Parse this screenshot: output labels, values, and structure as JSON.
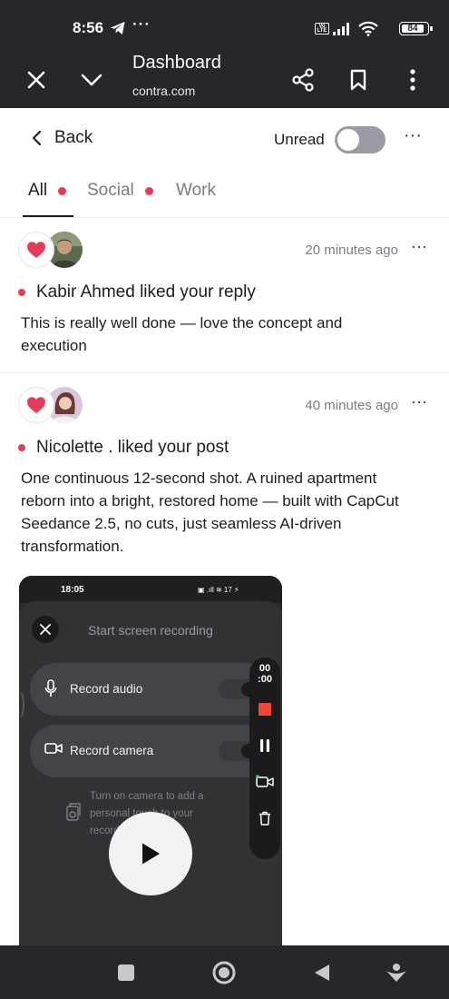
{
  "status_bar": {
    "time": "8:56",
    "dots": "···",
    "network_badge": "Vo LTE",
    "battery": "84"
  },
  "browser": {
    "title": "Dashboard",
    "url": "contra.com"
  },
  "header": {
    "back_label": "Back",
    "unread_label": "Unread",
    "unread_on": false,
    "more": "···"
  },
  "tabs": [
    {
      "label": "All",
      "active": true,
      "has_dot": true
    },
    {
      "label": "Social",
      "active": false,
      "has_dot": true
    },
    {
      "label": "Work",
      "active": false,
      "has_dot": false
    }
  ],
  "notifications": [
    {
      "time": "20 minutes ago",
      "more": "···",
      "title": "Kabir Ahmed liked your reply",
      "body": "This is really well done — love the concept and execution",
      "icon": "heart-icon"
    },
    {
      "time": "40 minutes ago",
      "more": "···",
      "title": "Nicolette . liked your post",
      "body": "One continuous 12-second shot. A ruined apartment reborn into a bright, restored home — built with CapCut Seedance 2.5, no cuts, just seamless AI-driven transformation.",
      "icon": "heart-icon",
      "preview": {
        "time": "18:05",
        "status_right": "▣ .ıll ≋ 17 ⚡",
        "title": "Start screen recording",
        "rows": [
          {
            "label": "Record audio",
            "icon": "microphone-icon"
          },
          {
            "label": "Record camera",
            "icon": "video-camera-icon"
          }
        ],
        "note": "Turn on camera to add a personal touch to your recording",
        "timer_top": "00",
        "timer_bottom": ":00"
      }
    }
  ],
  "colors": {
    "accent": "#e23c5a",
    "chrome": "#26262b"
  }
}
